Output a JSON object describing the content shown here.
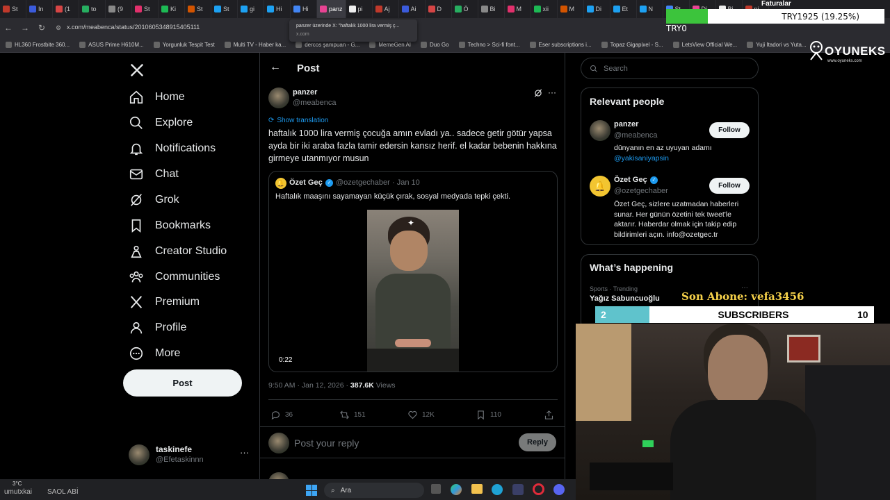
{
  "browser": {
    "tabs": [
      "St",
      "In",
      "(1",
      "to",
      "(9",
      "St",
      "Ki",
      "St",
      "St",
      "gi",
      "Hi",
      "Hi",
      "panz",
      "pi",
      "Aj",
      "Ai",
      "D",
      "Ö",
      "Bi",
      "M",
      "xii",
      "M",
      "Di",
      "Et",
      "N",
      "St",
      "Di",
      "Bi",
      "pi"
    ],
    "active_tab": "panz",
    "url": "x.com/meabenca/status/2010605348915405111",
    "tooltip_title": "panzer üzerinde X: \"haftalık 1000 lira vermiş ç...",
    "tooltip_url": "x.com",
    "bookmarks": [
      "HL360 Frostbite 360...",
      "ASUS Prime H610M...",
      "Yorgunluk Tespit Test",
      "Multi TV - Haber ka...",
      "dercos şampuan - G...",
      "MemeGen AI",
      "Duo Go",
      "Techno > Sci-fi font...",
      "Eser subscriptions i...",
      "Topaz Gigapixel - S...",
      "LetsView Official We...",
      "Yuji Itadori vs Yuta..."
    ]
  },
  "overlays": {
    "try_goal": "TRY1925 (19.25%)",
    "try_goal_progress": 0.1925,
    "try_label": "TRY0",
    "faturalar": "Faturalar",
    "brand": "OYUNEKS",
    "brand_url": "www.oyuneks.com",
    "son_abone": "Son Abone: vefa3456",
    "sub_count": "2",
    "sub_label": "SUBSCRIBERS",
    "sub_goal": "10",
    "chat_line": "SAOL ABİ",
    "chat_user": "umutxkai"
  },
  "nav": {
    "logo": "X",
    "items": [
      "Home",
      "Explore",
      "Notifications",
      "Chat",
      "Grok",
      "Bookmarks",
      "Creator Studio",
      "Communities",
      "Premium",
      "Profile",
      "More"
    ],
    "post_button": "Post",
    "me_name": "taskinefe",
    "me_handle": "@Efetaskinnn",
    "more_dots": "···"
  },
  "post": {
    "header": "Post",
    "author_name": "panzer",
    "author_handle": "@meabenca",
    "show_translation": "Show translation",
    "text": "haftalık 1000 lira vermiş çocuğa amın evladı ya.. sadece getir götür yapsa ayda bir iki araba fazla tamir edersin kansız herif. el kadar bebenin hakkına girmeye utanmıyor musun",
    "quote": {
      "name": "Özet Geç",
      "handle": "@ozetgechaber",
      "date": "· Jan 10",
      "text": "Haftalık maaşını sayamayan küçük çırak, sosyal medyada tepki çekti.",
      "duration": "0:22"
    },
    "timestamp": "9:50 AM · Jan 12, 2026 ·",
    "views_count": "387.6K",
    "views_label": "Views",
    "replies": "36",
    "reposts": "151",
    "likes": "12K",
    "bookmarks": "110",
    "reply_placeholder": "Post your reply",
    "reply_button": "Reply"
  },
  "sidebar": {
    "search_placeholder": "Search",
    "relevant_title": "Relevant people",
    "people": [
      {
        "name": "panzer",
        "handle": "@meabenca",
        "bio": "dünyanın en az uyuyan adamı",
        "bio_link": "@yakisaniyapsin",
        "follow": "Follow"
      },
      {
        "name": "Özet Geç",
        "handle": "@ozetgechaber",
        "bio": "Özet Geç, sizlere uzatmadan haberleri sunar. Her günün özetini tek tweet'le aktarır. Haberdar olmak için takip edip bildirimleri açın. info@ozetgec.tr",
        "follow": "Follow"
      }
    ],
    "happening_title": "What’s happening",
    "trend_meta": "Sports · Trending",
    "trend_name": "Yağız Sabuncuoğlu"
  },
  "taskbar": {
    "weather": "3°C",
    "search_label": "Ara"
  }
}
